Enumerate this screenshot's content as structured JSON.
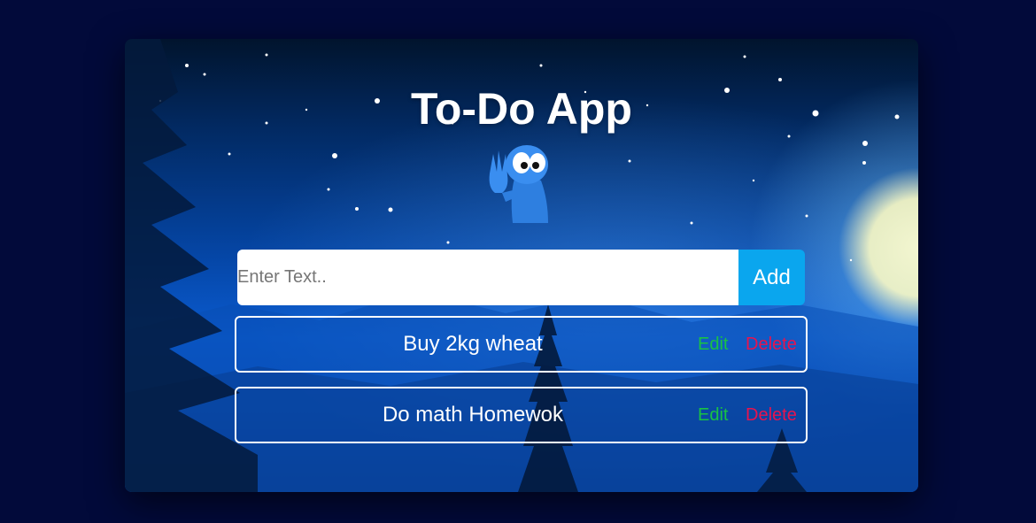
{
  "app": {
    "title": "To-Do App"
  },
  "form": {
    "input_value": "",
    "input_placeholder": "Enter Text..",
    "add_label": "Add"
  },
  "todos": [
    {
      "text": "Buy 2kg wheat",
      "edit_label": "Edit",
      "delete_label": "Delete"
    },
    {
      "text": "Do math Homewok",
      "edit_label": "Edit",
      "delete_label": "Delete"
    }
  ],
  "colors": {
    "page_background": "#020a3a",
    "add_button": "#0aa6ee",
    "edit": "#19c244",
    "delete": "#e8134e",
    "item_border": "#ffffff"
  },
  "icons": {
    "mascot": "waving-alien-mascot-icon"
  }
}
